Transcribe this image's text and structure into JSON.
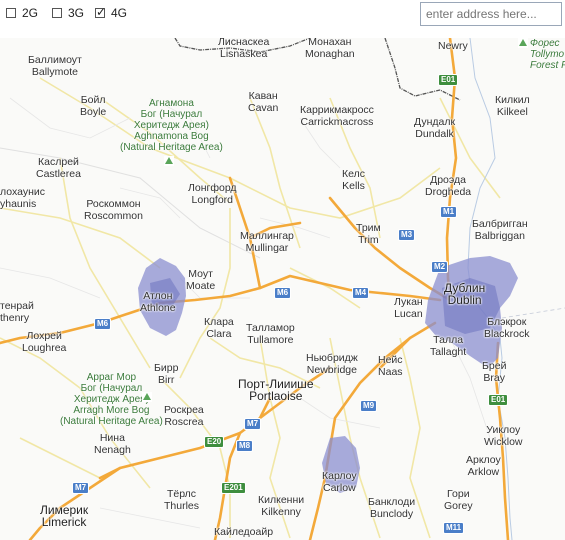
{
  "filters": [
    {
      "label": "2G",
      "checked": false
    },
    {
      "label": "3G",
      "checked": false
    },
    {
      "label": "4G",
      "checked": true
    }
  ],
  "search": {
    "placeholder": "enter address here..."
  },
  "places": {
    "lisnaskea": [
      "Лиснаскеа",
      "Lisnaskea"
    ],
    "monaghan": [
      "Монахан",
      "Monaghan"
    ],
    "newry": [
      "Newry"
    ],
    "forest": [
      "Форес",
      "Tollymo",
      "Forest P"
    ],
    "ballymote": [
      "Баллимоут",
      "Ballymote"
    ],
    "boyle": [
      "Бойл",
      "Boyle"
    ],
    "aghnamona": [
      "Агнамона",
      "Бог (Начурал",
      "Херитедж Арея)",
      "Aghnamona Bog",
      "(Natural Heritage Area)"
    ],
    "cavan": [
      "Каван",
      "Cavan"
    ],
    "carrickmacross": [
      "Каррикмакросс",
      "Carrickmacross"
    ],
    "dundalk": [
      "Дундалк",
      "Dundalk"
    ],
    "kilkeel": [
      "Килкил",
      "Kilkeel"
    ],
    "castlerea": [
      "Каслрей",
      "Castlerea"
    ],
    "longford": [
      "Лонгфорд",
      "Longford"
    ],
    "kells": [
      "Келс",
      "Kells"
    ],
    "drogheda": [
      "Дроэда",
      "Drogheda"
    ],
    "yhaunis": [
      "лохаунис",
      "yhaunis"
    ],
    "roscommon": [
      "Роскоммон",
      "Roscommon"
    ],
    "mullingar": [
      "Маллингар",
      "Mullingar"
    ],
    "trim": [
      "Трим",
      "Trim"
    ],
    "balbriggan": [
      "Балбригган",
      "Balbriggan"
    ],
    "athlone": [
      "Атлон",
      "Athlone"
    ],
    "moate": [
      "Моут",
      "Moate"
    ],
    "dublin": [
      "Дублин",
      "Dublin"
    ],
    "lucan": [
      "Лукан",
      "Lucan"
    ],
    "athenry": [
      "тенрай",
      "thenry"
    ],
    "clara": [
      "Клара",
      "Clara"
    ],
    "tullamore": [
      "Талламор",
      "Tullamore"
    ],
    "blackrock": [
      "Блэкрок",
      "Blackrock"
    ],
    "loughrea": [
      "Лохрей",
      "Loughrea"
    ],
    "tallaght": [
      "Талла",
      "Tallaght"
    ],
    "bray": [
      "Брей",
      "Bray"
    ],
    "birr": [
      "Бирр",
      "Birr"
    ],
    "newbridge": [
      "Ньюбридж",
      "Newbridge"
    ],
    "naas": [
      "Нейс",
      "Naas"
    ],
    "arragh": [
      "Арраг Мор",
      "Бог (Начурал",
      "Херитедж Арея)",
      "Arragh More Bog",
      "(Natural Heritage Area)"
    ],
    "portlaoise": [
      "Порт-Лииише",
      "Portlaoise"
    ],
    "roscrea": [
      "Роскреа",
      "Roscrea"
    ],
    "wicklow": [
      "Уиклоу",
      "Wicklow"
    ],
    "nenagh": [
      "Нина",
      "Nenagh"
    ],
    "carlow": [
      "Карлоу",
      "Carlow"
    ],
    "arklow": [
      "Арклоу",
      "Arklow"
    ],
    "thurles": [
      "Тёрлс",
      "Thurles"
    ],
    "kilkenny": [
      "Килкенни",
      "Kilkenny"
    ],
    "bunclody": [
      "Банклоди",
      "Bunclody"
    ],
    "gorey": [
      "Гори",
      "Gorey"
    ],
    "limerick": [
      "Лимерик",
      "Limerick"
    ],
    "kaileday": [
      "Кайледоайр"
    ]
  },
  "roads": [
    "E01",
    "M1",
    "M2",
    "M3",
    "M4",
    "M6",
    "M6",
    "M7",
    "M7",
    "M8",
    "M9",
    "E20",
    "E201",
    "E01",
    "M11"
  ],
  "colors": {
    "road_major": "#f3a93a",
    "coverage_4g": "#8b8fd0",
    "road_shield": "#4a7ec8",
    "euro_shield": "#3e8e3e"
  },
  "icons": [
    "park-tree-icon",
    "park-tree-icon",
    "park-tree-icon"
  ]
}
